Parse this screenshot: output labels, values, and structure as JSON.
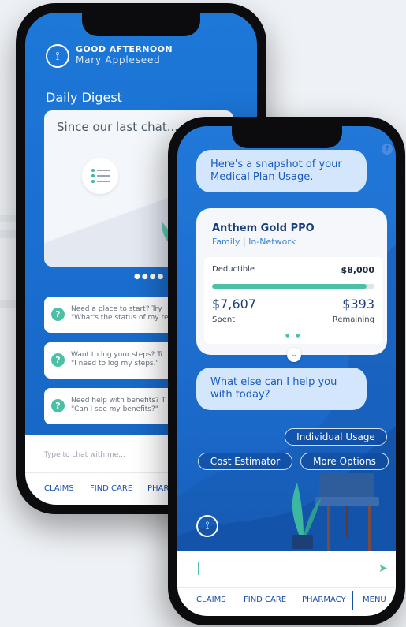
{
  "back_phone": {
    "greeting": "GOOD AFTERNOON",
    "user_name": "Mary Appleseed",
    "digest_title": "Daily Digest",
    "digest_card_text": "Since our last chat...",
    "pager": "●●●●",
    "prompts": [
      {
        "line1": "Need a place to start? Try",
        "line2": "\"What's the status of my re"
      },
      {
        "line1": "Want to log your steps? Tr",
        "line2": "\"I need to log my steps.\""
      },
      {
        "line1": "Need help with benefits? T",
        "line2": "\"Can I see my benefits?\""
      }
    ],
    "input_placeholder": "Type to chat with me...",
    "nav": [
      "CLAIMS",
      "FIND CARE",
      "PHARM"
    ]
  },
  "front_phone": {
    "intro_bubble": "Here's a snapshot of your Medical Plan Usage.",
    "plan": {
      "name": "Anthem Gold PPO",
      "subtitle": "Family | In-Network",
      "deductible_label": "Deductible",
      "deductible_total": "$8,000",
      "spent_value": "$7,607",
      "spent_label": "Spent",
      "remaining_value": "$393",
      "remaining_label": "Remaining",
      "spent_fraction": 0.95
    },
    "followup_bubble": "What else can I help you with today?",
    "chips": {
      "individual_usage": "Individual Usage",
      "cost_estimator": "Cost Estimator",
      "more_options": "More Options"
    },
    "nav": [
      "CLAIMS",
      "FIND CARE",
      "PHARMACY",
      "MENU"
    ]
  },
  "colors": {
    "brand_blue": "#1c6ccd",
    "accent_teal": "#4cc0a5",
    "bubble_bg": "#d4e6fb",
    "nav_text": "#1a4fa8"
  },
  "icons": [
    "logo-icon",
    "help-icon",
    "question-icon",
    "list-icon",
    "chevron-down-icon",
    "send-icon"
  ]
}
